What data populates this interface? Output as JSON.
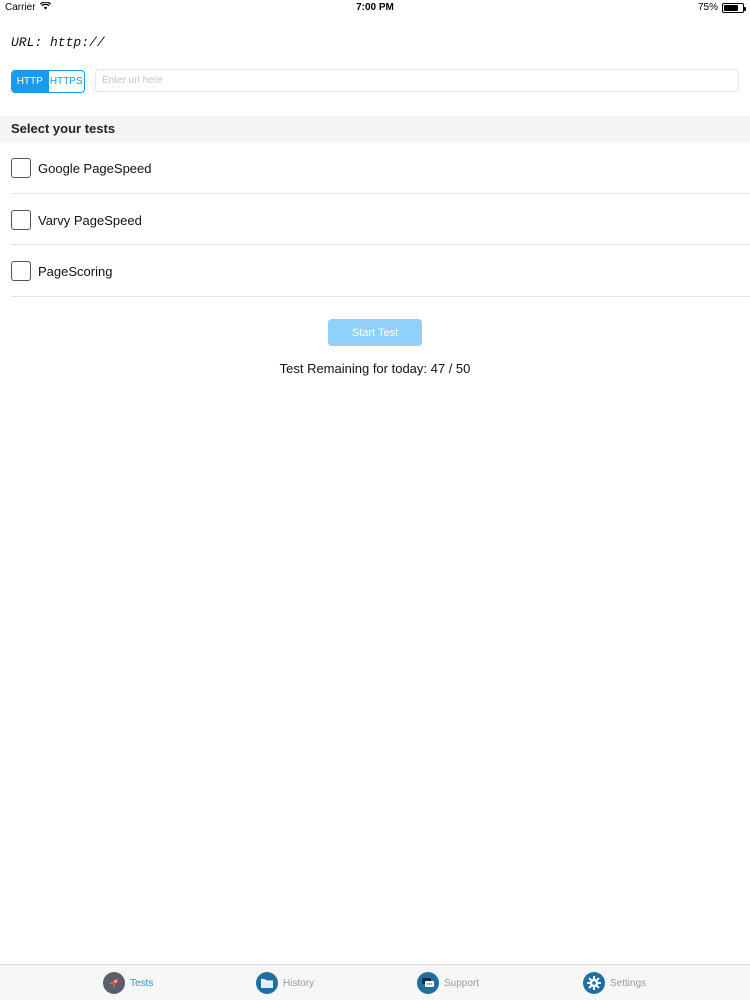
{
  "status_bar": {
    "carrier": "Carrier",
    "time": "7:00 PM",
    "battery": "75%",
    "battery_level": 0.75
  },
  "url_label": "URL: http://",
  "protocol": {
    "options": [
      "HTTP",
      "HTTPS"
    ],
    "selected": "HTTP"
  },
  "url_input": {
    "value": "",
    "placeholder": "Enter url here"
  },
  "tests_section": {
    "title": "Select your tests",
    "items": [
      {
        "label": "Google PageSpeed",
        "checked": false
      },
      {
        "label": "Varvy PageSpeed",
        "checked": false
      },
      {
        "label": "PageScoring",
        "checked": false
      }
    ]
  },
  "start_button": "Start Test",
  "remaining_text": "Test Remaining for today: 47 / 50",
  "tab_bar": {
    "tabs": [
      {
        "label": "Tests",
        "icon": "rocket-icon",
        "active": true
      },
      {
        "label": "History",
        "icon": "folder-icon",
        "active": false
      },
      {
        "label": "Support",
        "icon": "chat-icon",
        "active": false
      },
      {
        "label": "Settings",
        "icon": "gear-icon",
        "active": false
      }
    ]
  },
  "colors": {
    "accent": "#1a9bf0",
    "button_disabled": "#8fd1fb",
    "tab_icon_bg": "#1f6fa3"
  }
}
